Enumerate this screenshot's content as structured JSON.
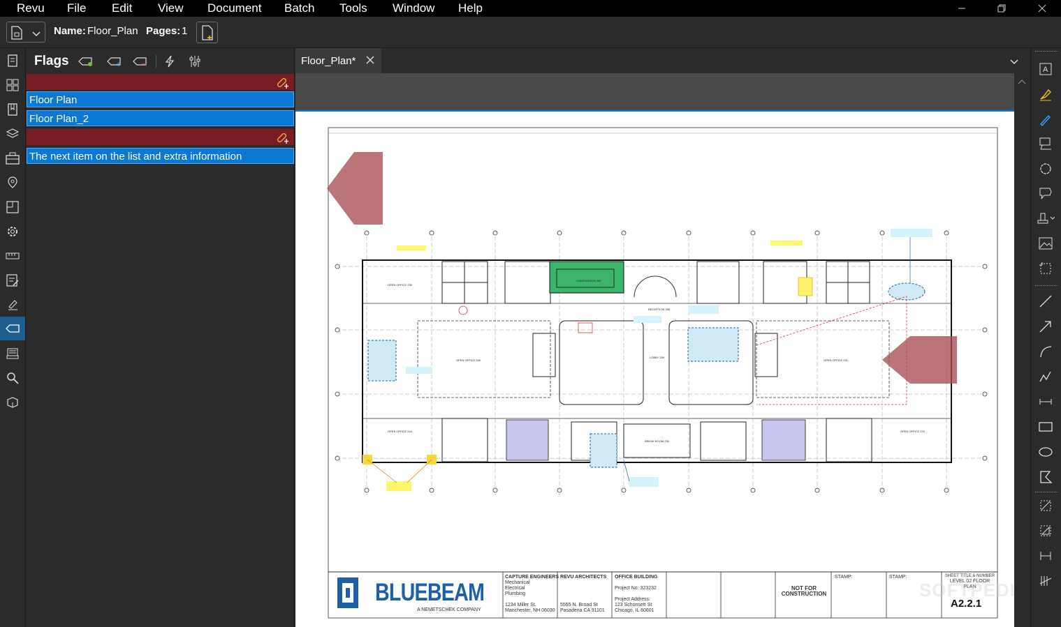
{
  "menu": {
    "items": [
      "Revu",
      "File",
      "Edit",
      "View",
      "Document",
      "Batch",
      "Tools",
      "Window",
      "Help"
    ]
  },
  "toolbar": {
    "name_label": "Name:",
    "name_value": "Floor_Plan",
    "pages_label": "Pages:",
    "pages_value": "1"
  },
  "left_rail": {
    "icons": [
      "thumbnails-icon",
      "grid-icon",
      "bookmark-icon",
      "layers-icon",
      "toolchest-icon",
      "places-icon",
      "links-icon",
      "properties-icon",
      "measure-icon",
      "markups-list-icon",
      "signature-icon",
      "flags-icon",
      "studio-icon",
      "search-icon",
      "spaces-icon"
    ],
    "active": "flags-icon"
  },
  "flags_panel": {
    "title": "Flags",
    "rows": [
      {
        "type": "red",
        "text": ""
      },
      {
        "type": "blue",
        "text": "Floor Plan"
      },
      {
        "type": "blue",
        "text": "Floor Plan_2"
      },
      {
        "type": "red",
        "text": ""
      },
      {
        "type": "blue",
        "text": "The next item on the list and extra information"
      }
    ]
  },
  "document_tab": {
    "label": "Floor_Plan*"
  },
  "title_block": {
    "brand": "BLUEBEAM",
    "brand_sub": "A NEMETSCHEK COMPANY",
    "engineers_title": "CAPTURE ENGINEERS",
    "engineers_lines": [
      "Mechanical",
      "Electrical",
      "Plumbing"
    ],
    "engineers_addr": [
      "1234 Miller St.",
      "Manchester, NH 06030"
    ],
    "architects_title": "REVU ARCHITECTS",
    "architects_addr": [
      "5555 N. Broad St",
      "Pasadena CA 91101"
    ],
    "building_title": "OFFICE BUILDING",
    "project_number": "Project No: 323232",
    "project_address_label": "Project Address:",
    "project_address": [
      "123 Schonsett St",
      "Chicago, IL 60601"
    ],
    "not_for_construction": [
      "NOT FOR",
      "CONSTRUCTION"
    ],
    "stamp1": "STAMP:",
    "stamp2": "STAMP:",
    "sheet_title_label": "SHEET TITLE & NUMBER",
    "sheet_title": [
      "LEVEL 02 FLOOR",
      "PLAN"
    ],
    "sheet_number": "A2.2.1"
  },
  "watermark": "SOFTPEDIA",
  "colors": {
    "accent": "#0a78d4",
    "flag_red": "#7a1c24",
    "markup_arrow": "#a64d55",
    "conference_green": "#3bb56b",
    "office_lavender": "#c8c6ef",
    "brand_blue": "#1d5fa8"
  }
}
